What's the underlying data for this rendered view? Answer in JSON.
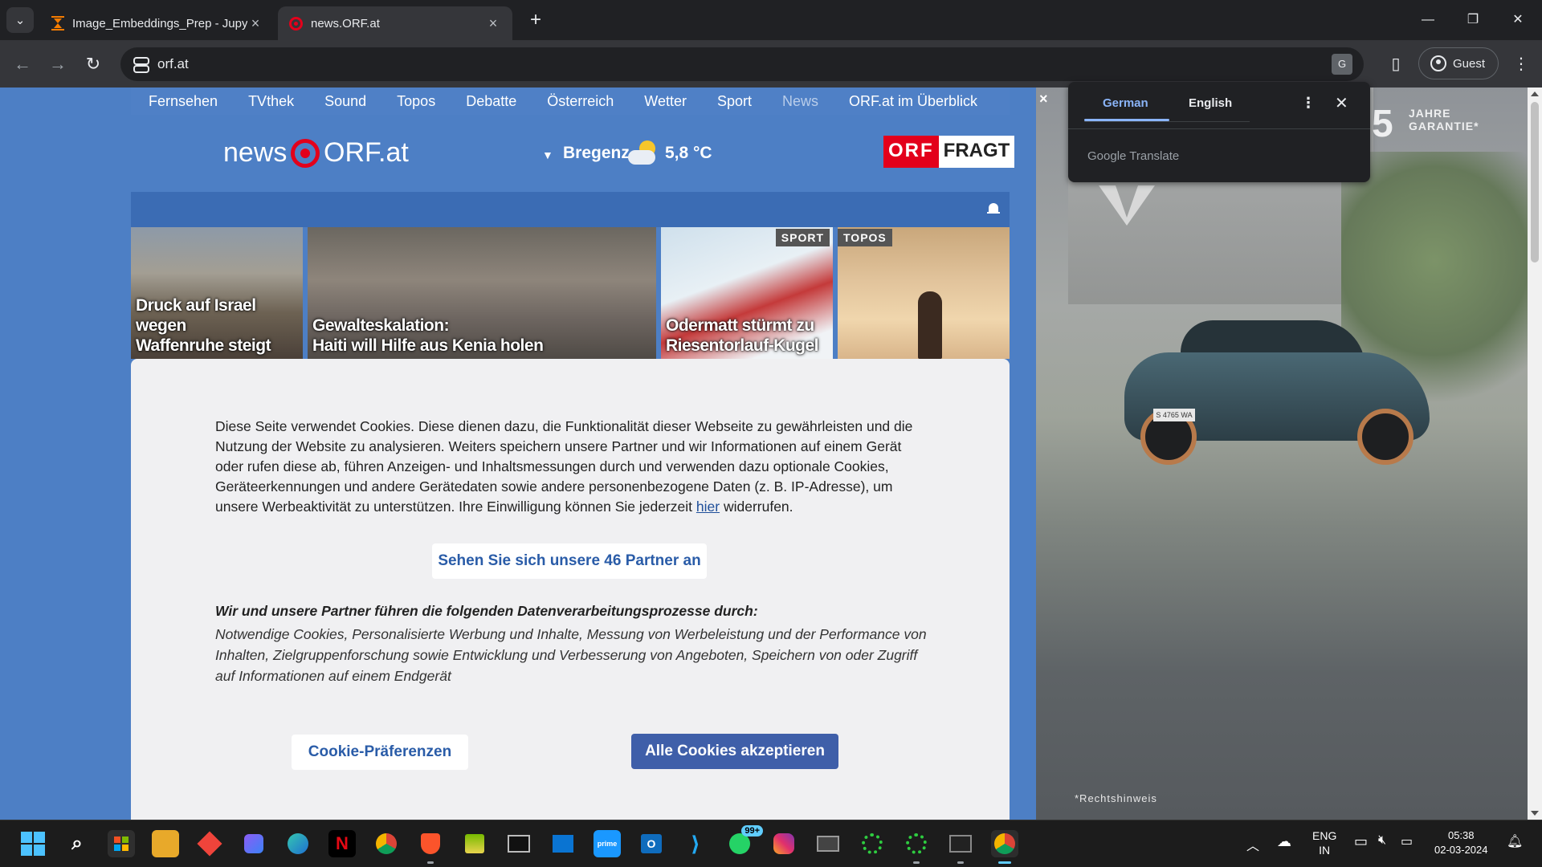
{
  "browser": {
    "tabs": [
      {
        "title": "Image_Embeddings_Prep - Jupyter",
        "icon": "hourglass-icon"
      },
      {
        "title": "news.ORF.at",
        "icon": "orf-favicon"
      }
    ],
    "url": "orf.at",
    "profile_label": "Guest"
  },
  "site": {
    "nav": [
      "Fernsehen",
      "TVthek",
      "Sound",
      "Topos",
      "Debatte",
      "Österreich",
      "Wetter",
      "Sport",
      "News",
      "ORF.at im Überblick"
    ],
    "nav_inactive": "News",
    "logo_news": "news",
    "logo_orf": "ORF.at",
    "weather": {
      "city": "Bregenz",
      "temp": "5,8 °C"
    },
    "orf_fragt": {
      "part1": "ORF",
      "part2": "FRAGT"
    },
    "teasers": [
      {
        "headline_line1": "Druck auf Israel wegen",
        "headline_line2": "Waffenruhe steigt",
        "tag": ""
      },
      {
        "headline_line1": "Gewalteskalation:",
        "headline_line2": "Haiti will Hilfe aus Kenia holen",
        "tag": ""
      },
      {
        "headline_line1": "Odermatt stürmt zu",
        "headline_line2": "Riesentorlauf-Kugel",
        "tag": "SPORT"
      },
      {
        "headline_line1": "",
        "headline_line2": "",
        "tag": "TOPOS"
      }
    ]
  },
  "cookie": {
    "text_main": "Diese Seite verwendet Cookies. Diese dienen dazu, die Funktionalität dieser Webseite zu gewährleisten und die Nutzung der Website zu analysieren. Weiters speichern unsere Partner und wir Informationen auf einem Gerät oder rufen diese ab, führen Anzeigen- und Inhaltsmessungen durch und verwenden dazu optionale Cookies, Geräteerkennungen und andere Gerätedaten sowie andere personenbezogene Daten (z. B. IP-Adresse), um unsere Werbeaktivität zu unterstützen. Ihre Einwilligung können Sie jederzeit ",
    "link": "hier",
    "text_end": " widerrufen.",
    "partners_button": "Sehen Sie sich unsere 46 Partner an",
    "processing_heading": "Wir und unsere Partner führen die folgenden Datenverarbeitungsprozesse durch:",
    "processing_list": "Notwendige Cookies, Personalisierte Werbung und Inhalte, Messung von Werbeleistung und der Performance von Inhalten, Zielgruppenforschung sowie Entwicklung und Verbesserung von Angeboten, Speichern von oder Zugriff auf Informationen auf einem Endgerät",
    "preferences_button": "Cookie-Präferenzen",
    "accept_button": "Alle Cookies akzeptieren"
  },
  "ad": {
    "close": "×",
    "logo_number": "5",
    "guarantee_line1": "JAHRE",
    "guarantee_line2": "GARANTIE*",
    "plate": "S 4765 WA",
    "footnote": "*Rechtshinweis"
  },
  "translate_popup": {
    "tab_source": "German",
    "tab_target": "English",
    "brand": "Google Translate"
  },
  "taskbar": {
    "whatsapp_badge": "99+",
    "lang_line1": "ENG",
    "lang_line2": "IN",
    "time": "05:38",
    "date": "02-03-2024"
  },
  "colors": {
    "orf_blue": "#4d7fc5",
    "orf_red": "#e3001b",
    "accept_button": "#3f5fa9",
    "translate_accent": "#8ab4f8"
  }
}
